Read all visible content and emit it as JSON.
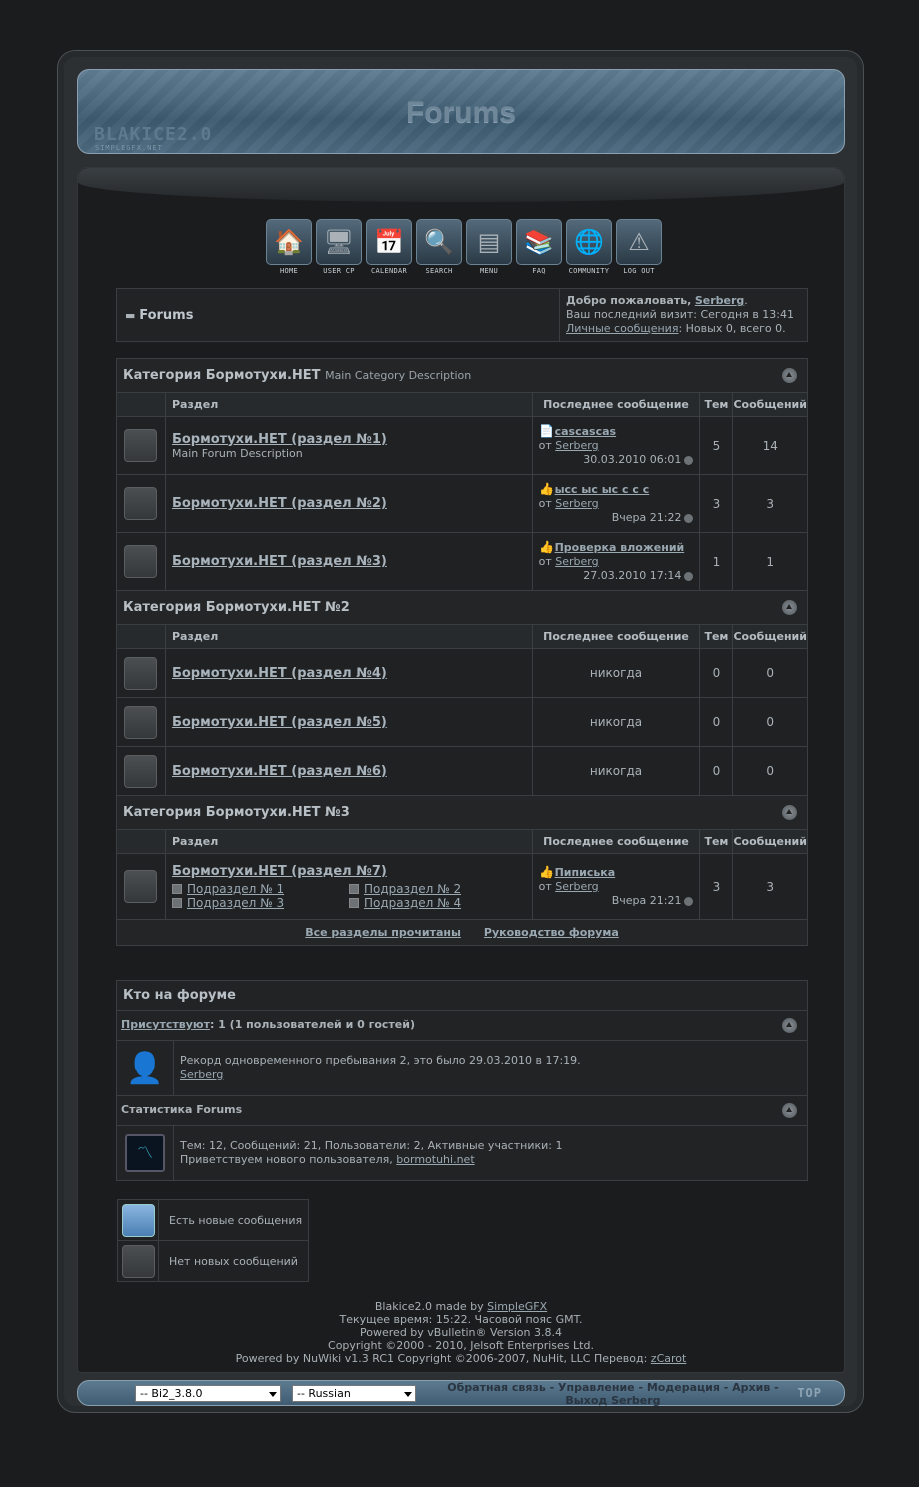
{
  "header": {
    "title": "Forums",
    "logo": "BLAKICE2.0",
    "logo_sub": "SIMPLEGFX.NET"
  },
  "nav": [
    {
      "label": "HOME",
      "icon": "home-icon",
      "glyph": "🏠"
    },
    {
      "label": "USER CP",
      "icon": "monitor-icon",
      "glyph": "🖥"
    },
    {
      "label": "CALENDAR",
      "icon": "calendar-icon",
      "glyph": "📅"
    },
    {
      "label": "SEARCH",
      "icon": "magnifier-icon",
      "glyph": "🔍"
    },
    {
      "label": "MENU",
      "icon": "menu-icon",
      "glyph": "▤"
    },
    {
      "label": "FAQ",
      "icon": "books-icon",
      "glyph": "📚"
    },
    {
      "label": "COMMUNITY",
      "icon": "globe-icon",
      "glyph": "🌐"
    },
    {
      "label": "LOG OUT",
      "icon": "warning-icon",
      "glyph": "⚠"
    }
  ],
  "welcome": {
    "breadcrumb": "Forums",
    "greeting": "Добро пожаловать,",
    "username": "Serberg",
    "last_visit": "Ваш последний визит: Сегодня в 13:41",
    "pm_link": "Личные сообщения",
    "pm_stats": ": Новых 0, всего 0."
  },
  "columns": {
    "forum": "Раздел",
    "last_post": "Последнее сообщение",
    "threads": "Тем",
    "posts": "Сообщений"
  },
  "categories": [
    {
      "title": "Категория Бормотухи.НЕТ",
      "desc": "Main Category Description",
      "forums": [
        {
          "name": "Бормотухи.НЕТ (раздел №1)",
          "desc": "Main Forum Description",
          "last_title": "cascascas",
          "last_by": "от",
          "last_user": "Serberg",
          "last_date": "30.03.2010 06:01",
          "threads": "5",
          "posts": "14"
        },
        {
          "name": "Бормотухи.НЕТ (раздел №2)",
          "desc": "",
          "last_title": "ысс ыс ыс с с с",
          "last_by": "от",
          "last_user": "Serberg",
          "last_date": "Вчера 21:22",
          "threads": "3",
          "posts": "3"
        },
        {
          "name": "Бормотухи.НЕТ (раздел №3)",
          "desc": "",
          "last_title": "Проверка вложений",
          "last_by": "от",
          "last_user": "Serberg",
          "last_date": "27.03.2010 17:14",
          "threads": "1",
          "posts": "1"
        }
      ]
    },
    {
      "title": "Категория Бормотухи.НЕТ №2",
      "desc": "",
      "forums": [
        {
          "name": "Бормотухи.НЕТ (раздел №4)",
          "never": "никогда",
          "threads": "0",
          "posts": "0"
        },
        {
          "name": "Бормотухи.НЕТ (раздел №5)",
          "never": "никогда",
          "threads": "0",
          "posts": "0"
        },
        {
          "name": "Бормотухи.НЕТ (раздел №6)",
          "never": "никогда",
          "threads": "0",
          "posts": "0"
        }
      ]
    },
    {
      "title": "Категория Бормотухи.НЕТ №3",
      "desc": "",
      "forums": [
        {
          "name": "Бормотухи.НЕТ (раздел №7)",
          "subforums": [
            "Подраздел № 1",
            "Подраздел № 2",
            "Подраздел № 3",
            "Подраздел № 4"
          ],
          "last_title": "Пиписька",
          "last_by": "от",
          "last_user": "Serberg",
          "last_date": "Вчера 21:21",
          "threads": "3",
          "posts": "3"
        }
      ]
    }
  ],
  "bottom_links": {
    "mark_read": "Все разделы прочитаны",
    "guide": "Руководство форума"
  },
  "whos_online": {
    "title": "Кто на форуме",
    "present_link": "Присутствуют",
    "present_text": ": 1 (1 пользователей и 0 гостей)",
    "record": "Рекорд одновременного пребывания 2, это было 29.03.2010 в 17:19.",
    "user": "Serberg",
    "stats_title": "Статистика Forums",
    "stats": "Тем: 12, Сообщений: 21, Пользователи: 2, Активные участники: 1",
    "welcome_new": "Приветствуем нового пользователя,",
    "new_user": "bormotuhi.net"
  },
  "legend": {
    "new": "Есть новые сообщения",
    "no_new": "Нет новых сообщений"
  },
  "footer": {
    "line1_pre": "Blakice2.0 made by",
    "line1_link": "SimpleGFX",
    "line2": "Текущее время: 15:22. Часовой пояс GMT.",
    "line3": "Powered by vBulletin® Version 3.8.4",
    "line4": "Copyright ©2000 - 2010, Jelsoft Enterprises Ltd.",
    "line5_pre": "Powered by NuWiki v1.3 RC1 Copyright ©2006-2007, NuHit, LLC Перевод:",
    "line5_link": "zCarot"
  },
  "bottombar": {
    "style_select": "-- Bi2_3.8.0",
    "lang_select": "-- Russian",
    "links": "Обратная связь - Управление - Модерация - Архив - Выход Serberg",
    "top": "TOP"
  }
}
